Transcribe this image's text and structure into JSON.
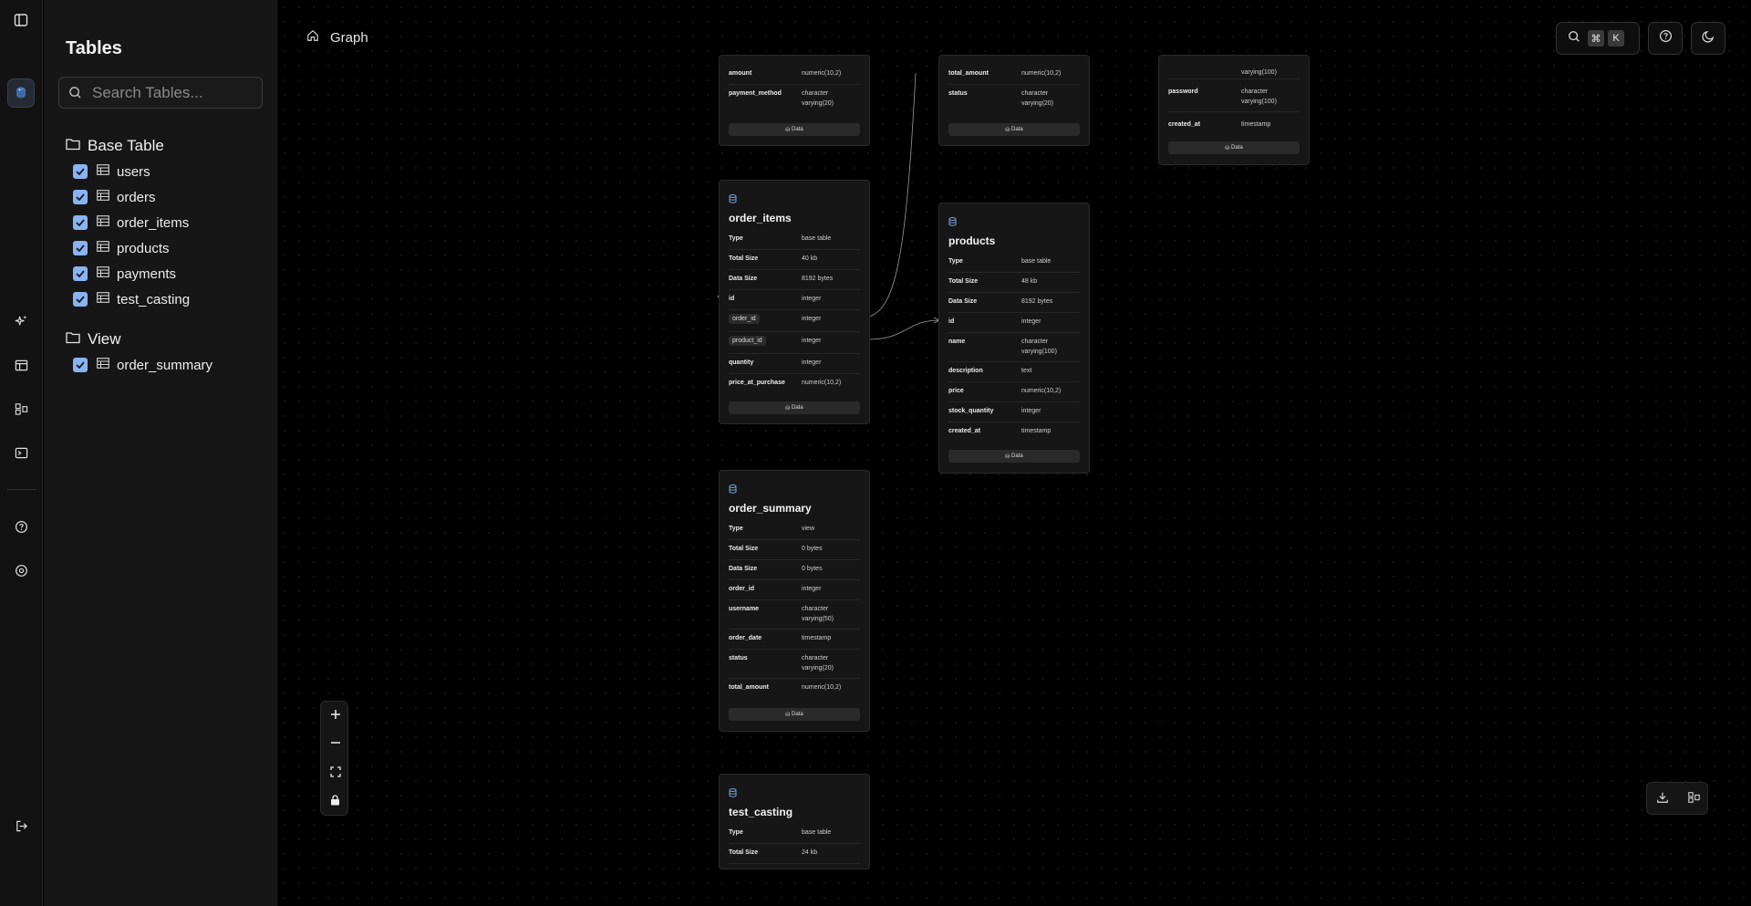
{
  "sidebar": {
    "title": "Tables",
    "search_placeholder": "Search Tables...",
    "groups": [
      {
        "label": "Base Table",
        "items": [
          "users",
          "orders",
          "order_items",
          "products",
          "payments",
          "test_casting"
        ]
      },
      {
        "label": "View",
        "items": [
          "order_summary"
        ]
      }
    ]
  },
  "header": {
    "breadcrumb": "Graph",
    "shortcut_keys": [
      "⌘",
      "K"
    ]
  },
  "cards": {
    "payments_partial": {
      "rows": [
        [
          "amount",
          "numeric(10,2)"
        ],
        [
          "payment_method",
          "character varying(20)"
        ]
      ],
      "data_label": "Data"
    },
    "orders_partial": {
      "rows": [
        [
          "total_amount",
          "numeric(10,2)"
        ],
        [
          "status",
          "character varying(20)"
        ]
      ],
      "data_label": "Data"
    },
    "users_partial": {
      "top_value": "varying(100)",
      "rows": [
        [
          "password",
          "character varying(100)"
        ],
        [
          "created_at",
          "timestamp"
        ]
      ],
      "data_label": "Data"
    },
    "order_items": {
      "title": "order_items",
      "rows": [
        [
          "Type",
          "base table"
        ],
        [
          "Total Size",
          "40 kb"
        ],
        [
          "Data Size",
          "8192 bytes"
        ],
        [
          "id",
          "integer"
        ],
        [
          "order_id",
          "integer"
        ],
        [
          "product_id",
          "integer"
        ],
        [
          "quantity",
          "integer"
        ],
        [
          "price_at_purchase",
          "numeric(10,2)"
        ]
      ],
      "data_label": "Data"
    },
    "products": {
      "title": "products",
      "rows": [
        [
          "Type",
          "base table"
        ],
        [
          "Total Size",
          "48 kb"
        ],
        [
          "Data Size",
          "8192 bytes"
        ],
        [
          "id",
          "integer"
        ],
        [
          "name",
          "character varying(100)"
        ],
        [
          "description",
          "text"
        ],
        [
          "price",
          "numeric(10,2)"
        ],
        [
          "stock_quantity",
          "integer"
        ],
        [
          "created_at",
          "timestamp"
        ]
      ],
      "data_label": "Data"
    },
    "order_summary": {
      "title": "order_summary",
      "rows": [
        [
          "Type",
          "view"
        ],
        [
          "Total Size",
          "0 bytes"
        ],
        [
          "Data Size",
          "0 bytes"
        ],
        [
          "order_id",
          "integer"
        ],
        [
          "username",
          "character varying(50)"
        ],
        [
          "order_date",
          "timestamp"
        ],
        [
          "status",
          "character varying(20)"
        ],
        [
          "total_amount",
          "numeric(10,2)"
        ]
      ],
      "data_label": "Data"
    },
    "test_casting": {
      "title": "test_casting",
      "rows": [
        [
          "Type",
          "base table"
        ],
        [
          "Total Size",
          "24 kb"
        ]
      ]
    }
  }
}
